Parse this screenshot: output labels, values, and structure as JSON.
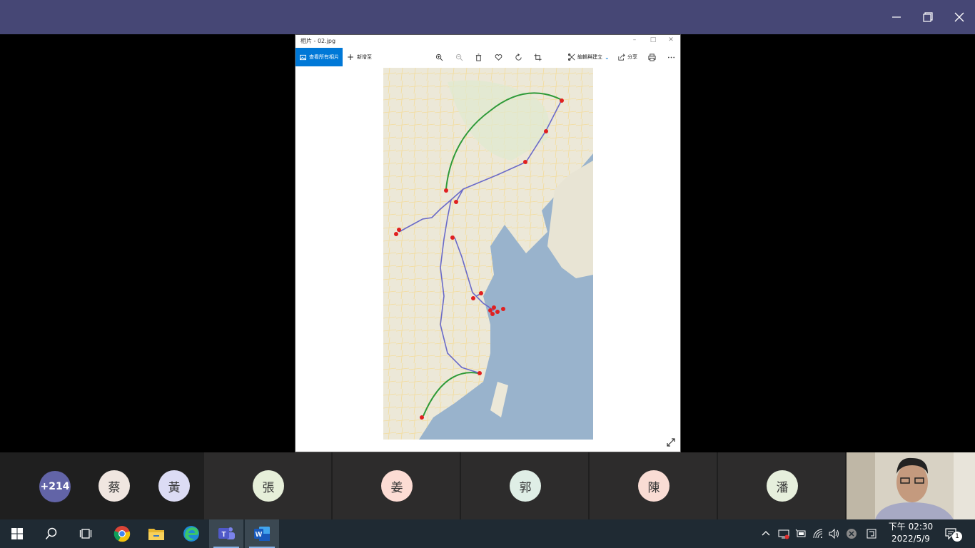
{
  "meeting": {
    "colors": {
      "titlebar": "#464775",
      "stage": "#000000"
    }
  },
  "photos_app": {
    "window_title": "相片 - 02.jpg",
    "toolbar": {
      "view_all_label": "查看所有相片",
      "add_label": "新增至",
      "edit_create_label": "編輯與建立",
      "share_label": "分享"
    }
  },
  "participants": {
    "overflow_count": "+214",
    "avatars": [
      "蔡",
      "黃",
      "張",
      "姜",
      "郭",
      "陳",
      "潘"
    ],
    "colors": {
      "overflow": "#6264a7",
      "cai": "#f0e6e0",
      "huang": "#dcdcf4",
      "zhang": "#e6efd9",
      "jiang": "#fcdcd4",
      "guo": "#dfeee6",
      "chen": "#f9dcd4",
      "pan": "#e6efdc"
    }
  },
  "taskbar": {
    "apps": [
      "start-icon",
      "search-icon",
      "task-view-icon",
      "chrome-icon",
      "file-explorer-icon",
      "edge-icon",
      "teams-icon",
      "word-icon"
    ],
    "clock_time": "下午 02:30",
    "clock_date": "2022/5/9",
    "notification_count": "1"
  }
}
